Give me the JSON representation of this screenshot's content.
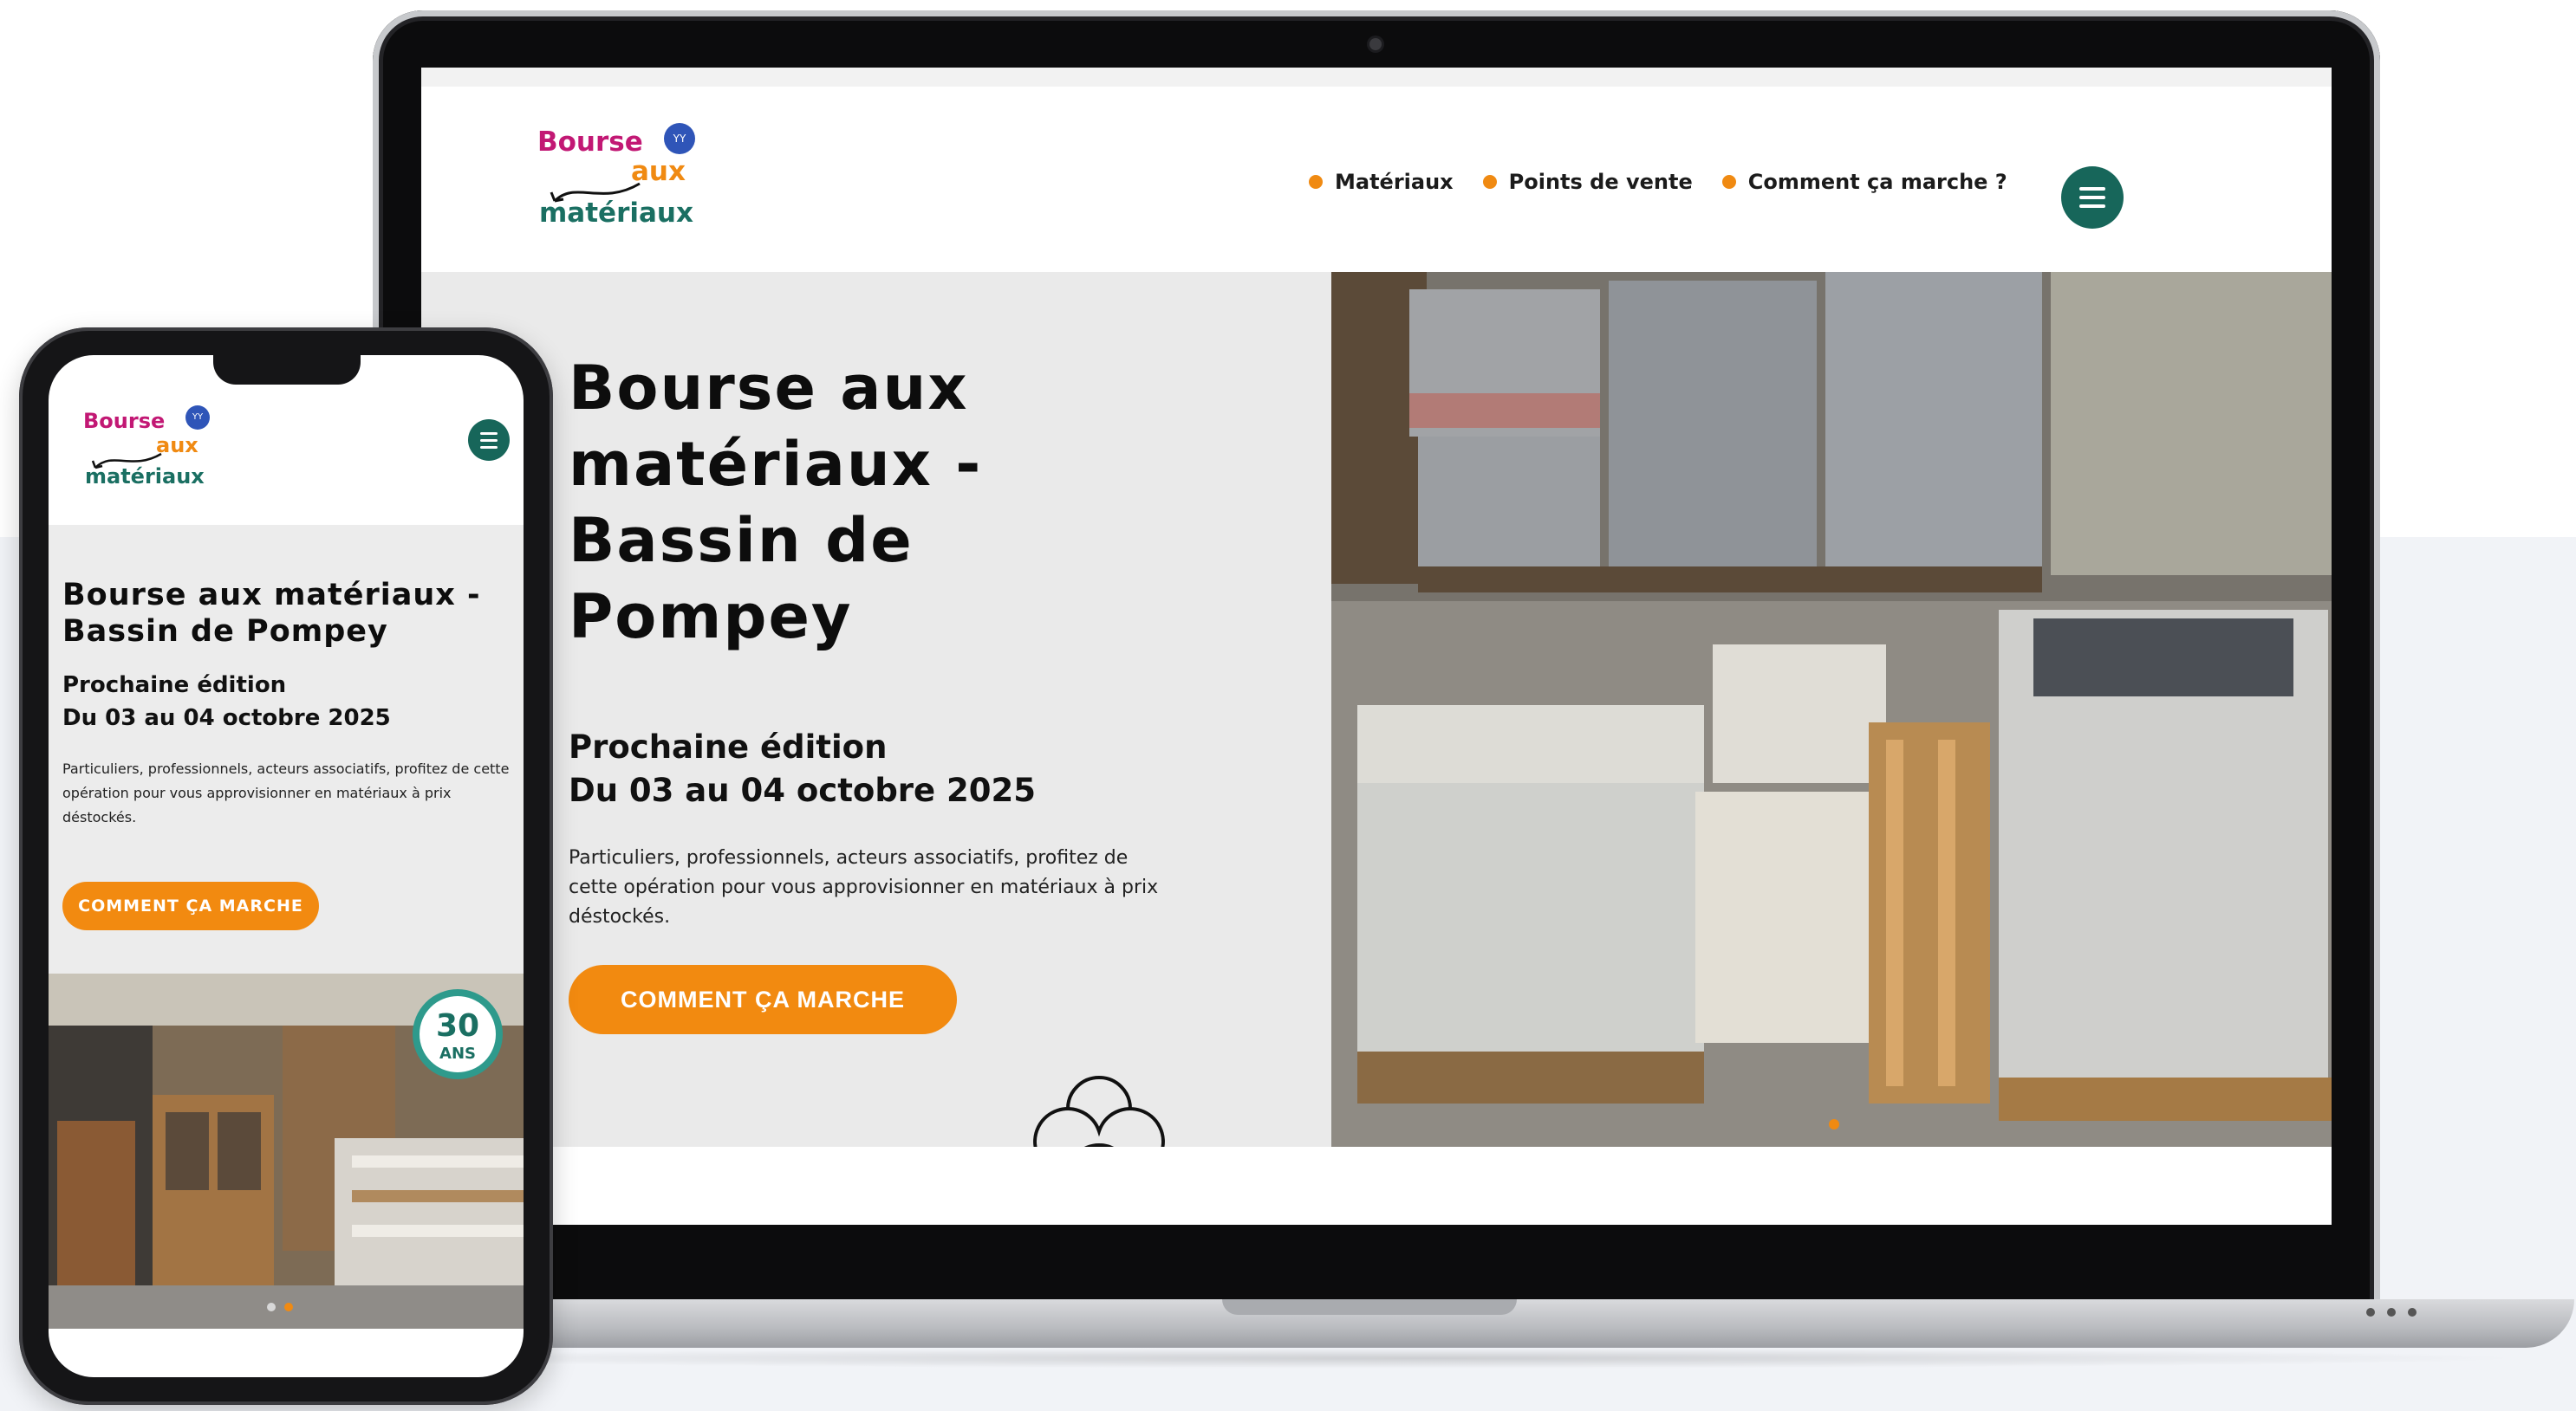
{
  "brand": {
    "logo_words": [
      "Bourse",
      "aux",
      "matériaux"
    ],
    "logo_badge": "YY",
    "colors": {
      "magenta": "#c21874",
      "orange": "#f08a12",
      "teal": "#17665a",
      "blue": "#2f55b8"
    }
  },
  "desktop": {
    "nav": [
      {
        "label": "Matériaux"
      },
      {
        "label": "Points de vente"
      },
      {
        "label": "Comment ça marche ?"
      }
    ],
    "menu_icon": "hamburger-menu-icon",
    "hero": {
      "title": "Bourse aux matériaux - Bassin de Pompey",
      "subtitle_1": "Prochaine édition",
      "subtitle_2": "Du 03 au 04 octobre 2025",
      "description": "Particuliers, professionnels, acteurs associatifs, profitez de cette opération pour vous approvisionner en matériaux à prix déstockés.",
      "cta_label": "COMMENT ÇA MARCHE",
      "image_alt": "pallets-of-tiles-photo"
    }
  },
  "mobile": {
    "menu_icon": "hamburger-menu-icon",
    "hero": {
      "title": "Bourse aux matériaux - Bassin de Pompey",
      "subtitle_1": "Prochaine édition",
      "subtitle_2": "Du 03 au 04 octobre 2025",
      "description": "Particuliers, professionnels, acteurs associatifs, profitez de cette opération pour vous approvisionner en matériaux à prix déstockés.",
      "cta_label": "COMMENT ÇA MARCHE",
      "image_alt": "windows-and-shutters-photo"
    },
    "photo_sticker": {
      "number": "30",
      "unit": "ANS"
    }
  }
}
